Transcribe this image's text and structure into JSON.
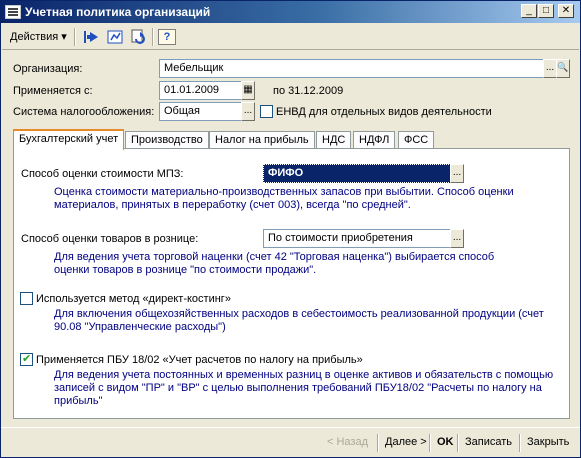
{
  "window": {
    "title": "Учетная политика организаций",
    "minimize_glyph": "_",
    "maximize_glyph": "□",
    "close_glyph": "✕"
  },
  "toolbar": {
    "actions_label": "Действия",
    "actions_arrow": "▾",
    "icons": [
      "back-arrow-icon",
      "struct-icon",
      "refresh-icon",
      "help-icon"
    ],
    "help_glyph": "?"
  },
  "form": {
    "organization_label": "Организация:",
    "organization_value": "Мебельщик",
    "applies_from_label": "Применяется с:",
    "applies_from_value": "01.01.2009",
    "applies_to_text": "по 31.12.2009",
    "tax_system_label": "Система налогообложения:",
    "tax_system_value": "Общая",
    "envd_label": "ЕНВД для отдельных видов деятельности",
    "envd_checked": false,
    "select_glyph": "...",
    "search_glyph": "🔍",
    "calendar_glyph": "▦"
  },
  "tabs": [
    "Бухгалтерский учет",
    "Производство",
    "Налог на прибыль",
    "НДС",
    "НДФЛ",
    "ФСС"
  ],
  "active_tab": 0,
  "accounting": {
    "mpz_label": "Способ оценки стоимости МПЗ:",
    "mpz_value": "ФИФО",
    "mpz_hint": "Оценка стоимости материально-производственных запасов при выбытии. Способ оценки материалов, принятых в переработку (счет 003), всегда \"по средней\".",
    "retail_label": "Способ оценки товаров в рознице:",
    "retail_value": "По стоимости приобретения",
    "retail_hint": "Для ведения учета торговой наценки (счет 42 \"Торговая наценка\") выбирается способ оценки товаров в рознице \"по стоимости продажи\".",
    "direct_costing_label": "Используется метод «директ-костинг»",
    "direct_costing_checked": false,
    "direct_costing_hint": "Для включения общехозяйственных расходов в себестоимость реализованной продукции (счет 90.08 \"Управленческие расходы\")",
    "pbu_label": "Применяется ПБУ 18/02 «Учет расчетов по налогу на прибыль»",
    "pbu_checked": true,
    "pbu_hint": "Для ведения учета постоянных и временных разниц в оценке активов и обязательств с помощью записей с видом \"ПР\" и \"ВР\" с целью выполнения требований ПБУ18/02 \"Расчеты по налогу на прибыль\""
  },
  "buttons": {
    "back": "< Назад",
    "next": "Далее >",
    "ok": "OK",
    "save": "Записать",
    "close": "Закрыть"
  },
  "colors": {
    "accent_orange": "#e68b2c",
    "hint_blue": "#000080",
    "selection_blue": "#0a246a"
  }
}
